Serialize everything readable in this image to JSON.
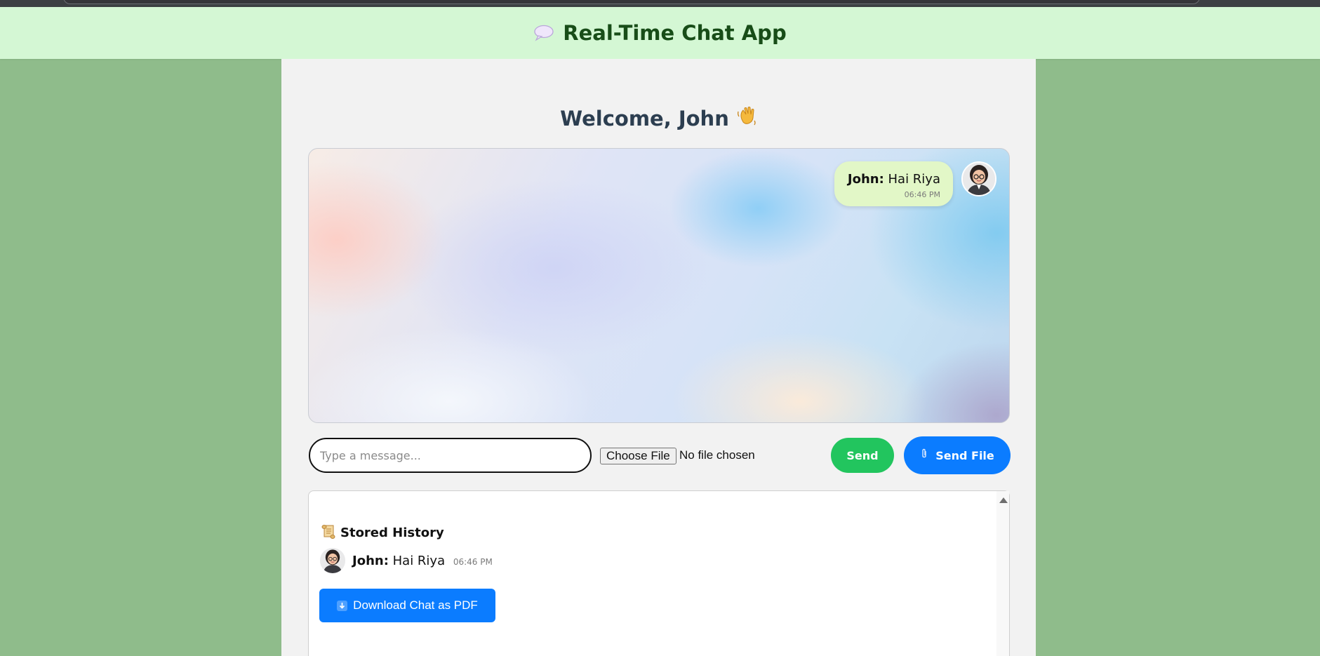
{
  "app": {
    "title": "Real-Time Chat App",
    "title_icon": "speech-bubble-icon"
  },
  "welcome": {
    "text": "Welcome, John",
    "icon": "waving-hand-icon"
  },
  "chat": {
    "messages": [
      {
        "sender": "John:",
        "text": "Hai Riya",
        "time": "06:46 PM",
        "avatar": "user-avatar"
      }
    ]
  },
  "composer": {
    "placeholder": "Type a message...",
    "choose_file_label": "Choose File",
    "file_status": "No file chosen",
    "send_label": "Send",
    "send_file_label": "Send File",
    "send_file_icon": "paperclip-icon"
  },
  "history": {
    "title": "Stored History",
    "title_icon": "scroll-icon",
    "items": [
      {
        "sender": "John:",
        "text": "Hai Riya",
        "time": "06:46 PM"
      }
    ],
    "download_label": "Download Chat as PDF",
    "download_icon": "down-arrow-icon"
  },
  "colors": {
    "page_bg": "#8fbc8b",
    "header_bg": "#d4f7d4",
    "header_text": "#184d18",
    "send": "#22c55e",
    "primary": "#0b7cff",
    "bubble": "#e2f7c7"
  }
}
